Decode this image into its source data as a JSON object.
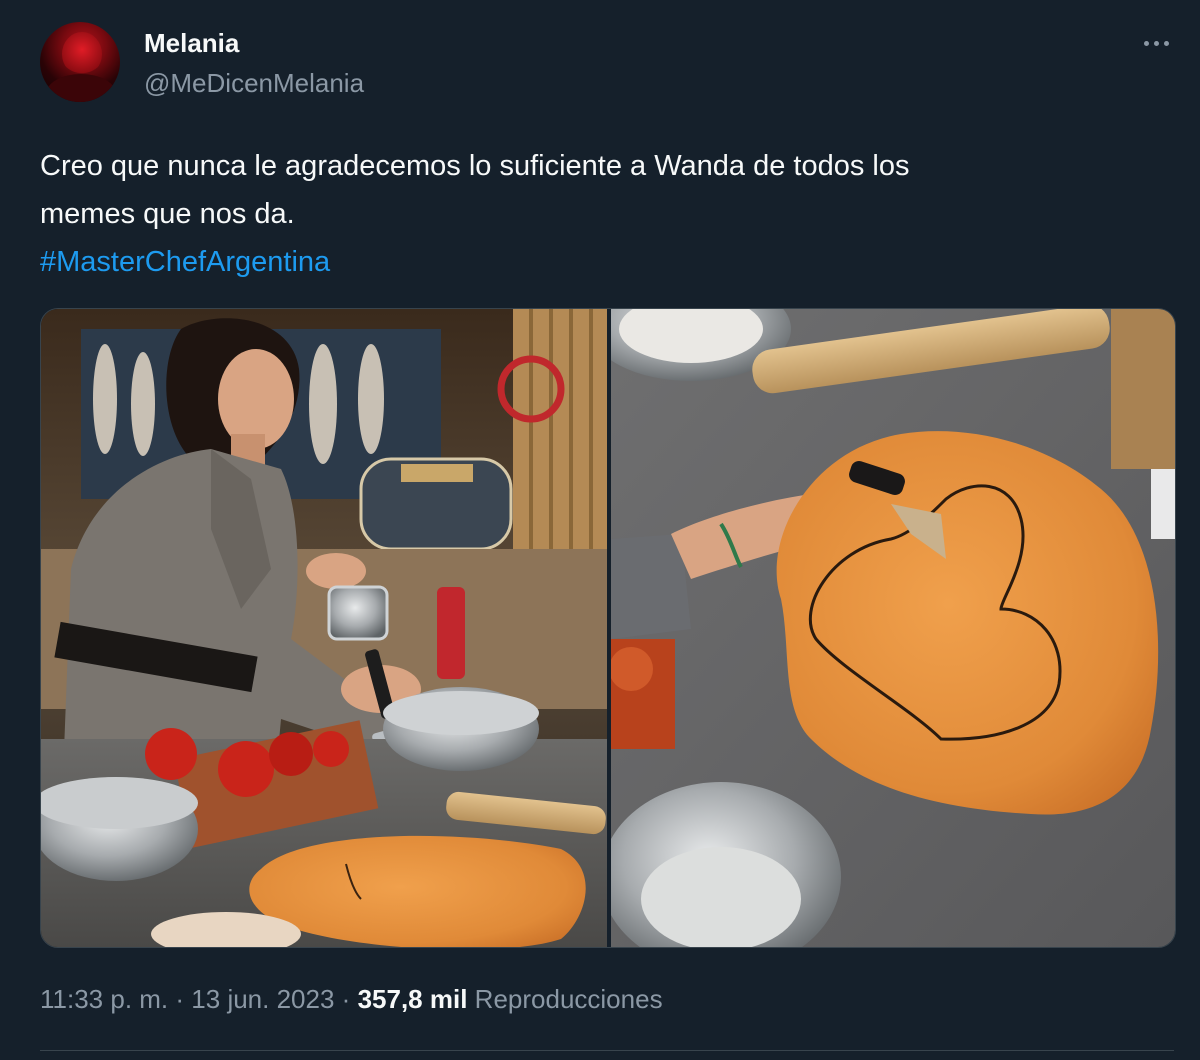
{
  "author": {
    "display_name": "Melania",
    "handle": "@MeDicenMelania"
  },
  "tweet": {
    "text_line1": "Creo que nunca le agradecemos lo suficiente a Wanda de todos los",
    "text_line2": "memes que nos da.",
    "hashtag": "#MasterChefArgentina"
  },
  "meta": {
    "time": "11:33 p. m.",
    "separator": "·",
    "date": "13 jun. 2023",
    "views_count": "357,8 mil",
    "views_label": "Reproducciones"
  },
  "colors": {
    "background": "#15202b",
    "text": "#f7f9f9",
    "secondary_text": "#8b98a5",
    "link": "#1d9bf0",
    "border": "#38444d"
  },
  "icons": {
    "more": "more-horizontal-icon"
  }
}
